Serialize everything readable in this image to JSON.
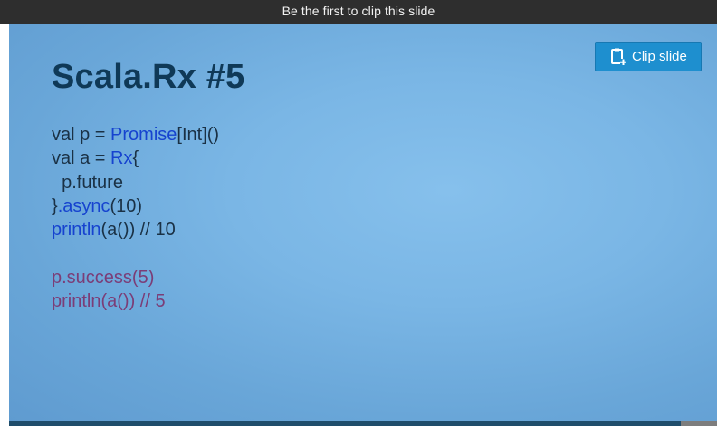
{
  "top_bar": {
    "text": "Be the first to clip this slide"
  },
  "clip_button": {
    "label": "Clip slide",
    "icon": "clipboard-plus-icon"
  },
  "slide": {
    "title": "Scala.Rx #5",
    "code_lines": [
      [
        {
          "text": "val p = ",
          "role": "plain"
        },
        {
          "text": "Promise",
          "role": "kw"
        },
        {
          "text": "[Int]()",
          "role": "plain"
        }
      ],
      [
        {
          "text": "val a = ",
          "role": "plain"
        },
        {
          "text": "Rx",
          "role": "kw"
        },
        {
          "text": "{",
          "role": "plain"
        }
      ],
      [
        {
          "text": "  p.future",
          "role": "plain"
        }
      ],
      [
        {
          "text": "}",
          "role": "plain"
        },
        {
          "text": ".async",
          "role": "kw"
        },
        {
          "text": "(10)",
          "role": "plain"
        }
      ],
      [
        {
          "text": "println",
          "role": "kw"
        },
        {
          "text": "(a()) // 10",
          "role": "plain"
        }
      ],
      [
        {
          "text": "",
          "role": "plain"
        }
      ],
      [
        {
          "text": "p.success(5)",
          "role": "pu"
        }
      ],
      [
        {
          "text": "println(a()) // 5",
          "role": "pu"
        }
      ]
    ]
  },
  "colors": {
    "topbar": "#2e2e2e",
    "slide_bg": "#7ab6e5",
    "title": "#0f3957",
    "keyword": "#1643cf",
    "plain_code": "#1a3145",
    "purple_code": "#7b3d77",
    "button": "#1e8fcf"
  }
}
